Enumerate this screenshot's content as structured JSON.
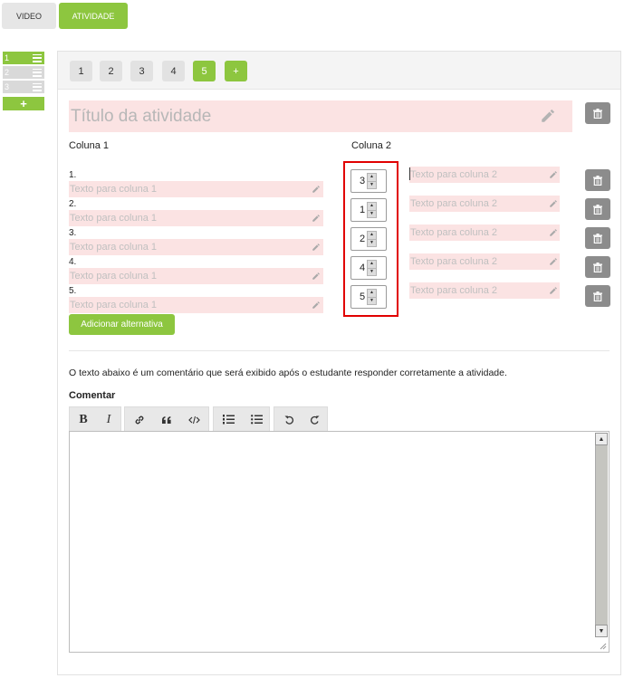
{
  "top_tabs": {
    "video": "VIDEO",
    "atividade": "ATIVIDADE"
  },
  "sidebar": {
    "items": [
      {
        "label": "1",
        "state": "active"
      },
      {
        "label": "2",
        "state": "inactive"
      },
      {
        "label": "3",
        "state": "inactive"
      }
    ],
    "add_label": "+"
  },
  "activity_tabs": [
    "1",
    "2",
    "3",
    "4",
    "5",
    "+"
  ],
  "active_tab": "5",
  "title_placeholder": "Título da atividade",
  "columns": {
    "col1_label": "Coluna 1",
    "col2_label": "Coluna 2"
  },
  "column1": {
    "placeholder": "Texto para coluna 1",
    "items": [
      "1.",
      "2.",
      "3.",
      "4.",
      "5."
    ]
  },
  "steppers": [
    "3",
    "1",
    "2",
    "4",
    "5"
  ],
  "column2": {
    "placeholder": "Texto para coluna 2"
  },
  "add_alternative_label": "Adicionar alternativa",
  "comment": {
    "note": "O texto abaixo é um comentário que será exibido após o estudante responder corretamente a atividade.",
    "label": "Comentar"
  },
  "toolbar": {
    "bold": "B",
    "italic": "I"
  },
  "colors": {
    "accent": "#8dc63f",
    "input_bg": "#fbe3e3",
    "highlight": "#e10000",
    "trash": "#8c8c8c"
  }
}
